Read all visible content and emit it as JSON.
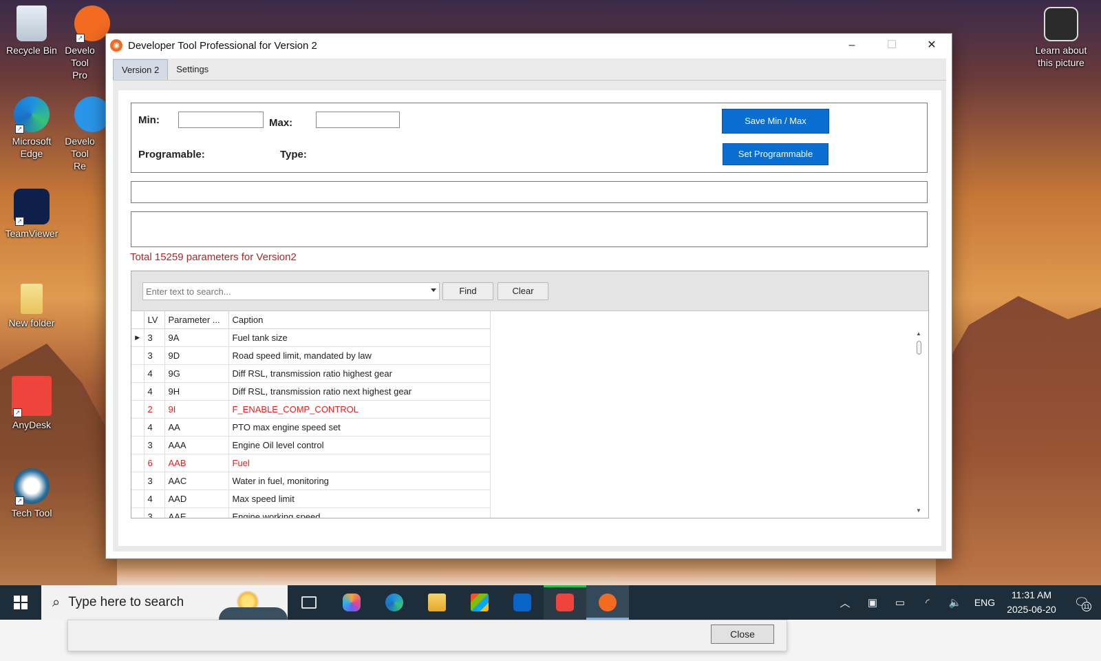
{
  "desktop": {
    "icons": [
      {
        "label": "Recycle Bin"
      },
      {
        "label": "Develo Tool Pro"
      },
      {
        "label": "Microsoft Edge"
      },
      {
        "label": "Develo Tool Re"
      },
      {
        "label": "TeamViewer"
      },
      {
        "label": "New folder"
      },
      {
        "label": "AnyDesk"
      },
      {
        "label": "Tech Tool"
      }
    ],
    "learn_about": "Learn about this picture"
  },
  "window": {
    "title": "Developer Tool Professional for Version 2",
    "controls": {
      "minimize": "–",
      "maximize": "☐",
      "close": "✕"
    },
    "tabs": [
      {
        "label": "Version 2",
        "active": true
      },
      {
        "label": "Settings",
        "active": false
      }
    ],
    "params_box": {
      "min_label": "Min:",
      "min_value": "",
      "max_label": "Max:",
      "max_value": "",
      "programable_label": "Programable:",
      "type_label": "Type:",
      "save_button": "Save Min / Max",
      "set_button": "Set Programmable"
    },
    "total_text": "Total 15259 parameters for Version2",
    "search": {
      "placeholder": "Enter text to search...",
      "find_button": "Find",
      "clear_button": "Clear"
    },
    "grid": {
      "columns": [
        "LV",
        "Parameter ...",
        "Caption"
      ],
      "rows": [
        {
          "lv": "3",
          "param": "9A",
          "caption": "Fuel tank size",
          "highlight": false,
          "current": true
        },
        {
          "lv": "3",
          "param": "9D",
          "caption": "Road speed limit, mandated by law",
          "highlight": false
        },
        {
          "lv": "4",
          "param": "9G",
          "caption": "Diff RSL, transmission ratio highest gear",
          "highlight": false
        },
        {
          "lv": "4",
          "param": "9H",
          "caption": "Diff RSL, transmission ratio next highest gear",
          "highlight": false
        },
        {
          "lv": "2",
          "param": "9I",
          "caption": "F_ENABLE_COMP_CONTROL",
          "highlight": true
        },
        {
          "lv": "4",
          "param": "AA",
          "caption": "PTO max engine speed set",
          "highlight": false
        },
        {
          "lv": "3",
          "param": "AAA",
          "caption": "Engine Oil level control",
          "highlight": false
        },
        {
          "lv": "6",
          "param": "AAB",
          "caption": "Fuel",
          "highlight": true
        },
        {
          "lv": "3",
          "param": "AAC",
          "caption": "Water in fuel, monitoring",
          "highlight": false
        },
        {
          "lv": "4",
          "param": "AAD",
          "caption": "Max speed limit",
          "highlight": false
        },
        {
          "lv": "3",
          "param": "AAE",
          "caption": "Engine working speed",
          "highlight": false
        }
      ]
    }
  },
  "taskbar": {
    "search_placeholder": "Type here to search",
    "apps": [
      "task-view",
      "copilot",
      "edge",
      "file-explorer",
      "store",
      "outlook",
      "anydesk",
      "developer-tool"
    ],
    "language": "ENG",
    "time": "11:31 AM",
    "date": "2025-06-20",
    "notifications": "11"
  },
  "bottom_dialog": {
    "close_button": "Close"
  },
  "colors": {
    "accent_blue": "#0a6ed1",
    "total_text": "#a52a2a",
    "highlight_row": "#e02020",
    "app_orange": "#f26b21"
  }
}
